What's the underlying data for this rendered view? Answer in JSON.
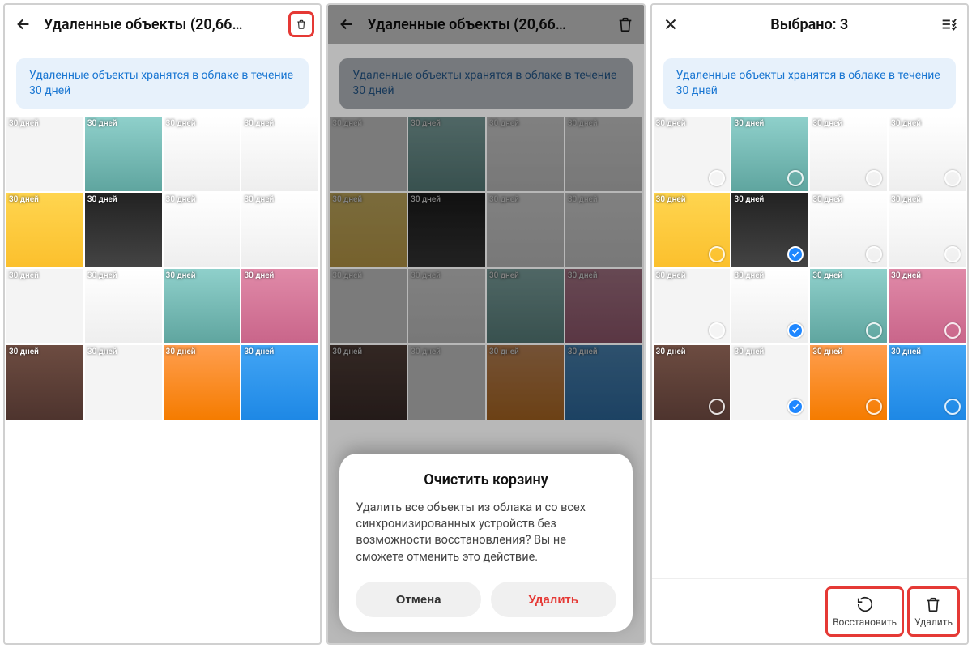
{
  "screen1": {
    "title": "Удаленные объекты (20,66…",
    "banner": "Удаленные объекты хранятся в облаке в течение 30 дней",
    "badge": "30 дней"
  },
  "screen2": {
    "title": "Удаленные объекты (20,66…",
    "banner": "Удаленные объекты хранятся в облаке в течение 30 дней",
    "badge": "30 дней",
    "dialog": {
      "title": "Очистить корзину",
      "body": "Удалить все объекты из облака и со всех синхронизированных устройств без возможности восстановления? Вы не сможете отменить это действие.",
      "cancel": "Отмена",
      "delete": "Удалить"
    }
  },
  "screen3": {
    "title": "Выбрано: 3",
    "banner": "Удаленные объекты хранятся в облаке в течение 30 дней",
    "badge": "30 дней",
    "restore": "Восстановить",
    "delete": "Удалить",
    "selected_count": 3
  },
  "thumb_styles": [
    "bg-light",
    "bg-teal",
    "bg-doc",
    "bg-doc",
    "bg-taxi",
    "bg-dark",
    "bg-doc",
    "bg-doc",
    "bg-light",
    "bg-doc",
    "bg-teal",
    "bg-pink",
    "bg-brown",
    "bg-light",
    "bg-orange",
    "bg-pack"
  ],
  "s3_checked": [
    5,
    9,
    13
  ]
}
